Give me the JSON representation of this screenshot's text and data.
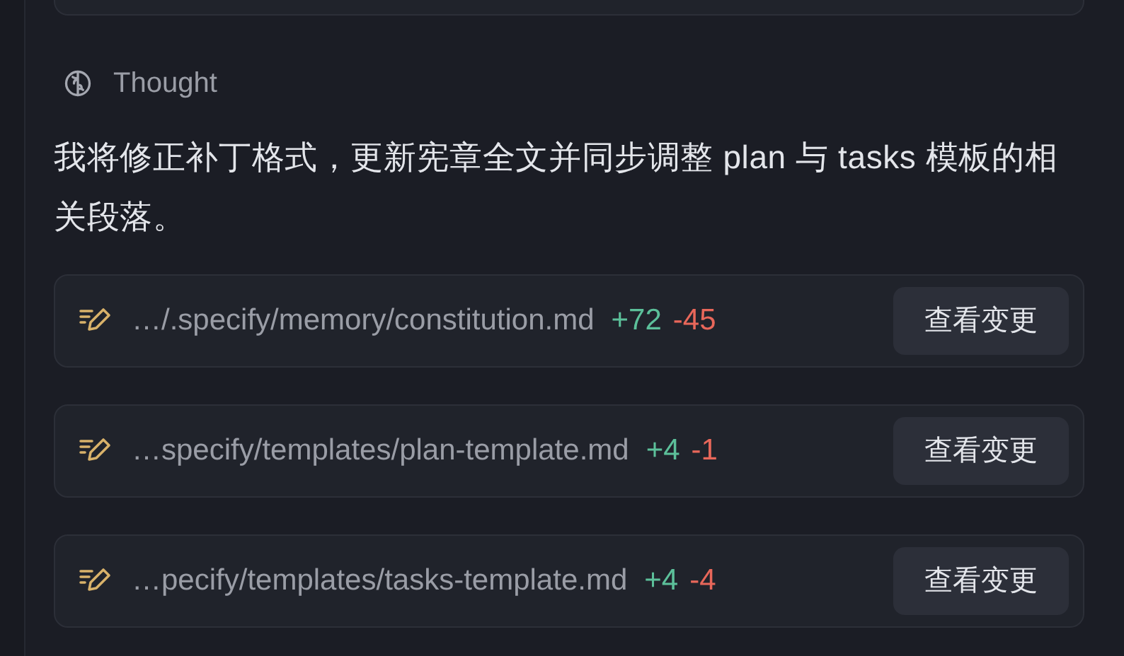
{
  "thought": {
    "label": "Thought",
    "text": "我将修正补丁格式，更新宪章全文并同步调整 plan 与 tasks 模板的相关段落。"
  },
  "files": [
    {
      "path": "…/.specify/memory/constitution.md",
      "added": "+72",
      "removed": "-45",
      "button": "查看变更"
    },
    {
      "path": "…specify/templates/plan-template.md",
      "added": "+4",
      "removed": "-1",
      "button": "查看变更"
    },
    {
      "path": "…pecify/templates/tasks-template.md",
      "added": "+4",
      "removed": "-4",
      "button": "查看变更"
    }
  ]
}
